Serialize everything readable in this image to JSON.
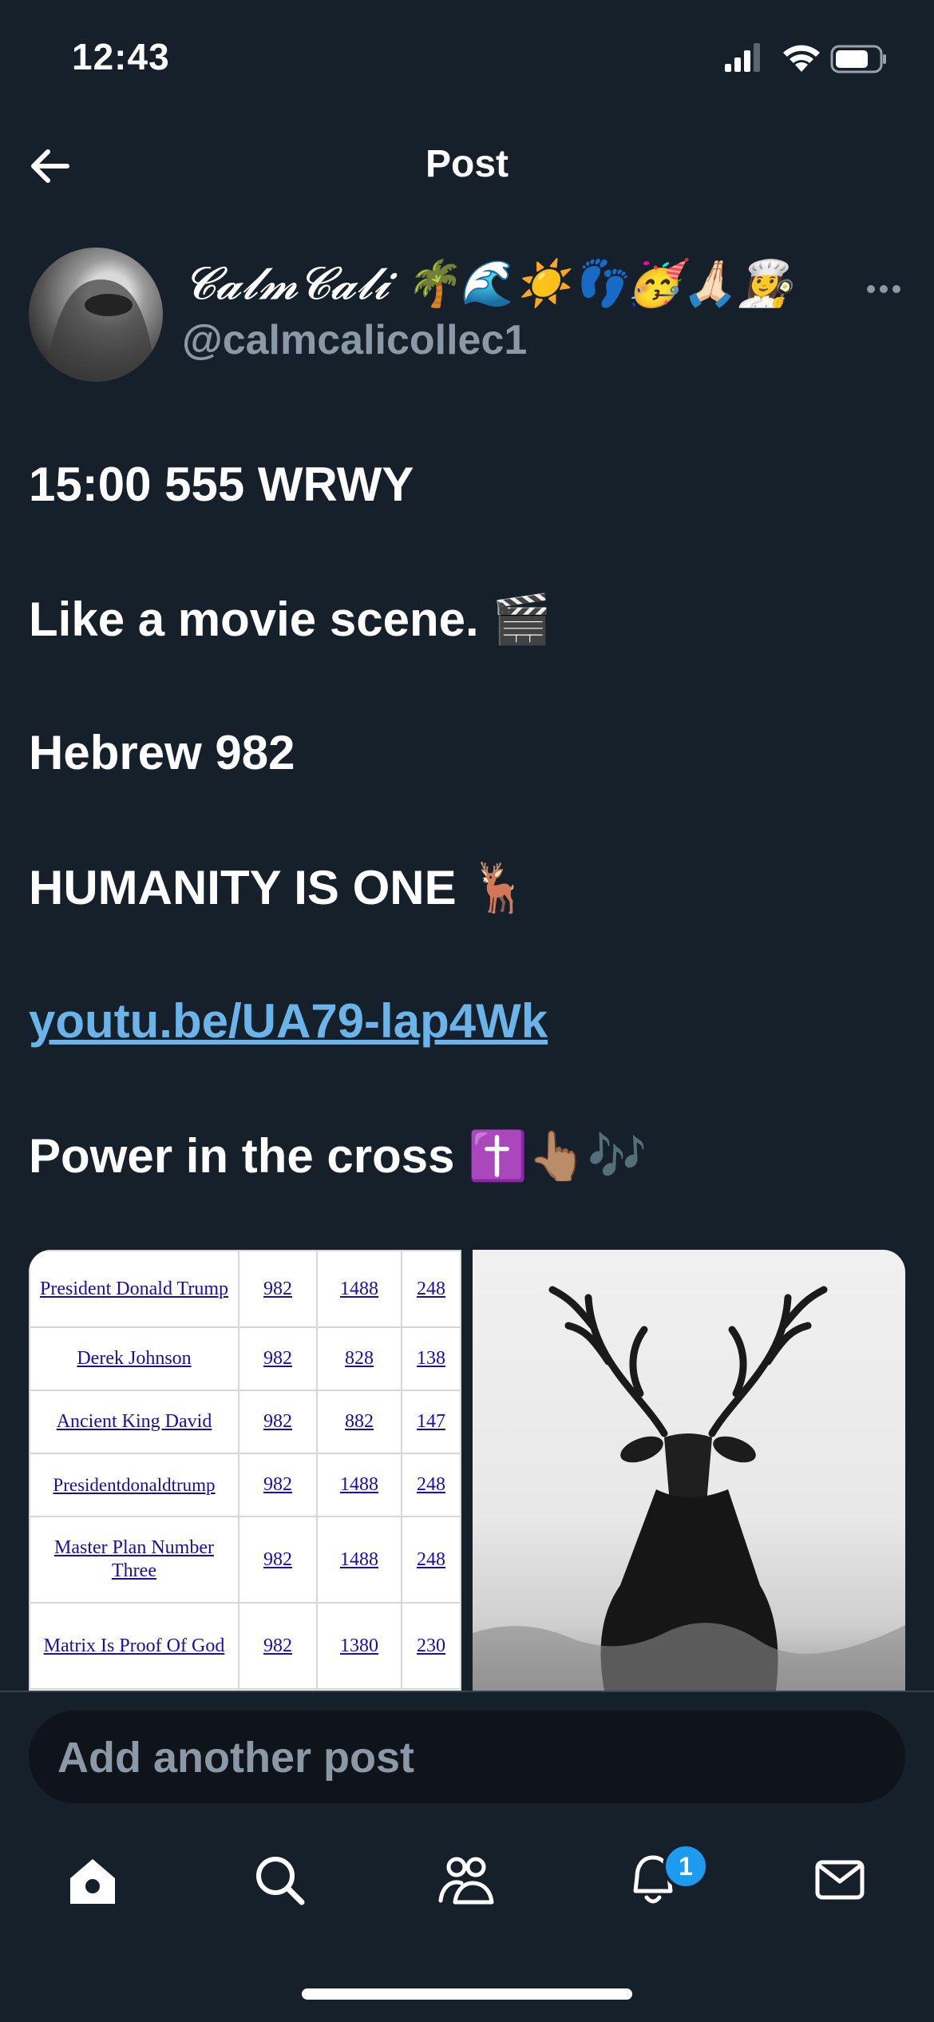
{
  "status_bar": {
    "time": "12:43"
  },
  "header": {
    "title": "Post"
  },
  "author": {
    "display_name": "𝓒𝓪𝓵𝓶𝓒𝓪𝓵𝓲 🌴🌊☀️👣🥳🙏🏻👩‍🍳",
    "handle": "@calmcalicollec1"
  },
  "post": {
    "line1": "15:00 555  WRWY",
    "line2": "Like a movie scene. 🎬",
    "line3": "Hebrew 982",
    "line4": "HUMANITY IS ONE 🦌",
    "link": "youtu.be/UA79-lap4Wk",
    "line6": "Power in the cross ✝️👆🏽🎶"
  },
  "media": {
    "table_rows": [
      [
        "President Donald Trump",
        "982",
        "1488",
        "248"
      ],
      [
        "Derek Johnson",
        "982",
        "828",
        "138"
      ],
      [
        "Ancient King David",
        "982",
        "882",
        "147"
      ],
      [
        "Presidentdonaldtrump",
        "982",
        "1488",
        "248"
      ],
      [
        "Master Plan Number Three",
        "982",
        "1488",
        "248"
      ],
      [
        "Matrix Is Proof Of God",
        "982",
        "1380",
        "230"
      ]
    ]
  },
  "compose": {
    "placeholder": "Add another post"
  },
  "tab_bar": {
    "items": [
      "home-icon",
      "search-icon",
      "communities-icon",
      "notifications-icon",
      "messages-icon"
    ],
    "notification_count": "1"
  },
  "colors": {
    "background": "#15202b",
    "link": "#6ab4ea",
    "muted": "#8b98a5",
    "badge": "#1d9bf0"
  }
}
